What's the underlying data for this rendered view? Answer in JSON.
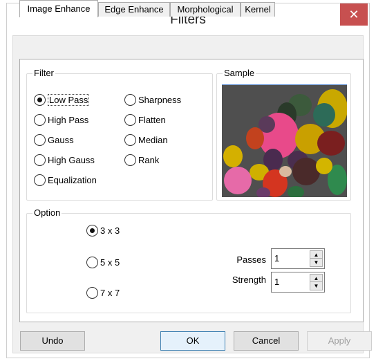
{
  "window": {
    "title": "Filters",
    "close_glyph": "✕"
  },
  "tabs": [
    {
      "label": "Image Enhance",
      "active": true
    },
    {
      "label": "Edge Enhance",
      "active": false
    },
    {
      "label": "Morphological",
      "active": false
    },
    {
      "label": "Kernel",
      "active": false
    }
  ],
  "filter_group": {
    "title": "Filter",
    "options": [
      {
        "label": "Low Pass",
        "checked": true
      },
      {
        "label": "High Pass",
        "checked": false
      },
      {
        "label": "Gauss",
        "checked": false
      },
      {
        "label": "High Gauss",
        "checked": false
      },
      {
        "label": "Equalization",
        "checked": false
      },
      {
        "label": "Sharpness",
        "checked": false
      },
      {
        "label": "Flatten",
        "checked": false
      },
      {
        "label": "Median",
        "checked": false
      },
      {
        "label": "Rank",
        "checked": false
      }
    ]
  },
  "sample_group": {
    "title": "Sample"
  },
  "option_group": {
    "title": "Option",
    "sizes": [
      {
        "label": "3 x 3",
        "checked": true
      },
      {
        "label": "5 x 5",
        "checked": false
      },
      {
        "label": "7 x 7",
        "checked": false
      }
    ],
    "passes": {
      "label": "Passes",
      "value": "1"
    },
    "strength": {
      "label": "Strength",
      "value": "1"
    }
  },
  "buttons": {
    "undo": "Undo",
    "ok": "OK",
    "cancel": "Cancel",
    "apply": "Apply"
  },
  "icons": {
    "spin_up": "▲",
    "spin_down": "▼"
  },
  "colors": {
    "close_bg": "#c75050",
    "default_button_border": "#3c7fb1",
    "sample_bg": "#4f4f4f"
  }
}
